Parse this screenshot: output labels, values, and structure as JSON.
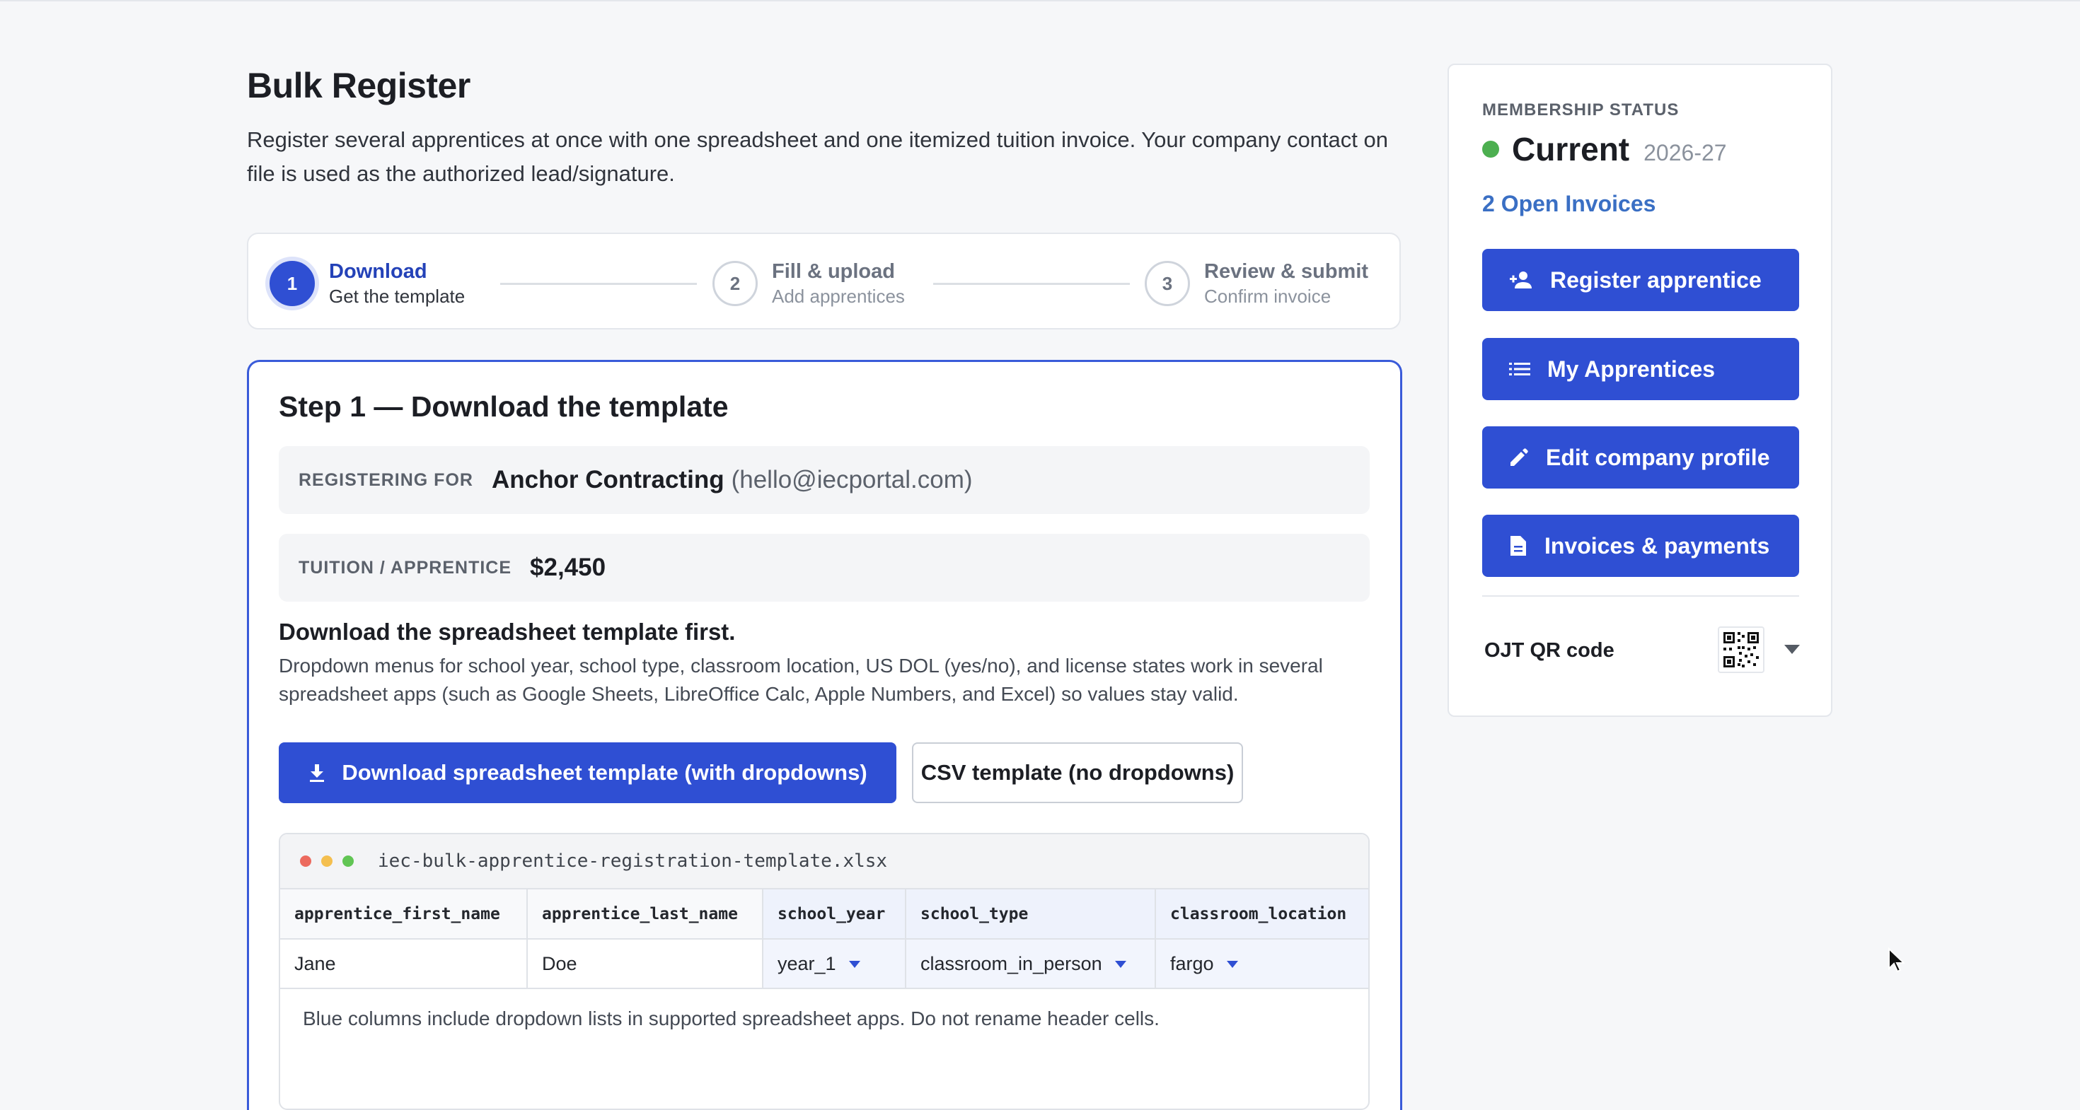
{
  "page": {
    "title": "Bulk Register",
    "intro": "Register several apprentices at once with one spreadsheet and one itemized tuition invoice. Your company contact on file is used as the authorized lead/signature."
  },
  "stepper": [
    {
      "number": "1",
      "title": "Download",
      "subtitle": "Get the template",
      "active": true
    },
    {
      "number": "2",
      "title": "Fill & upload",
      "subtitle": "Add apprentices",
      "active": false
    },
    {
      "number": "3",
      "title": "Review & submit",
      "subtitle": "Confirm invoice",
      "active": false
    }
  ],
  "step1": {
    "title": "Step 1 — Download the template",
    "registering_label": "Registering for",
    "company_name": "Anchor Contracting",
    "company_email": "(hello@iecportal.com)",
    "tuition_label": "Tuition / apprentice",
    "tuition_value": "$2,450",
    "download_heading": "Download the spreadsheet template first.",
    "download_desc": "Dropdown menus for school year, school type, classroom location, US DOL (yes/no), and license states work in several spreadsheet apps (such as Google Sheets, LibreOffice Calc, Apple Numbers, and Excel) so values stay valid.",
    "btn_download": "Download spreadsheet template (with dropdowns)",
    "btn_csv": "CSV template (no dropdowns)"
  },
  "spreadsheet": {
    "filename": "iec-bulk-apprentice-registration-template.xlsx",
    "headers": [
      "apprentice_first_name",
      "apprentice_last_name",
      "school_year",
      "school_type",
      "classroom_location"
    ],
    "row": [
      "Jane",
      "Doe",
      "year_1",
      "classroom_in_person",
      "fargo"
    ],
    "dropdown_columns": [
      "school_year",
      "school_type",
      "classroom_location"
    ],
    "note": "Blue columns include dropdown lists in supported spreadsheet apps. Do not rename header cells."
  },
  "sidebar": {
    "membership_label": "MEMBERSHIP STATUS",
    "status": "Current",
    "status_year": "2026-27",
    "status_color": "#4caf50",
    "open_invoices": "2 Open Invoices",
    "buttons": [
      {
        "label": "Register apprentice",
        "icon": "person-add-icon"
      },
      {
        "label": "My Apprentices",
        "icon": "list-icon"
      },
      {
        "label": "Edit company profile",
        "icon": "pencil-icon"
      },
      {
        "label": "Invoices & payments",
        "icon": "document-icon"
      }
    ],
    "ojt_label": "OJT QR code"
  },
  "colors": {
    "primary": "#2f4fd3",
    "link": "#3a6fc4",
    "dropdown_column_bg": "#eef2fc"
  }
}
